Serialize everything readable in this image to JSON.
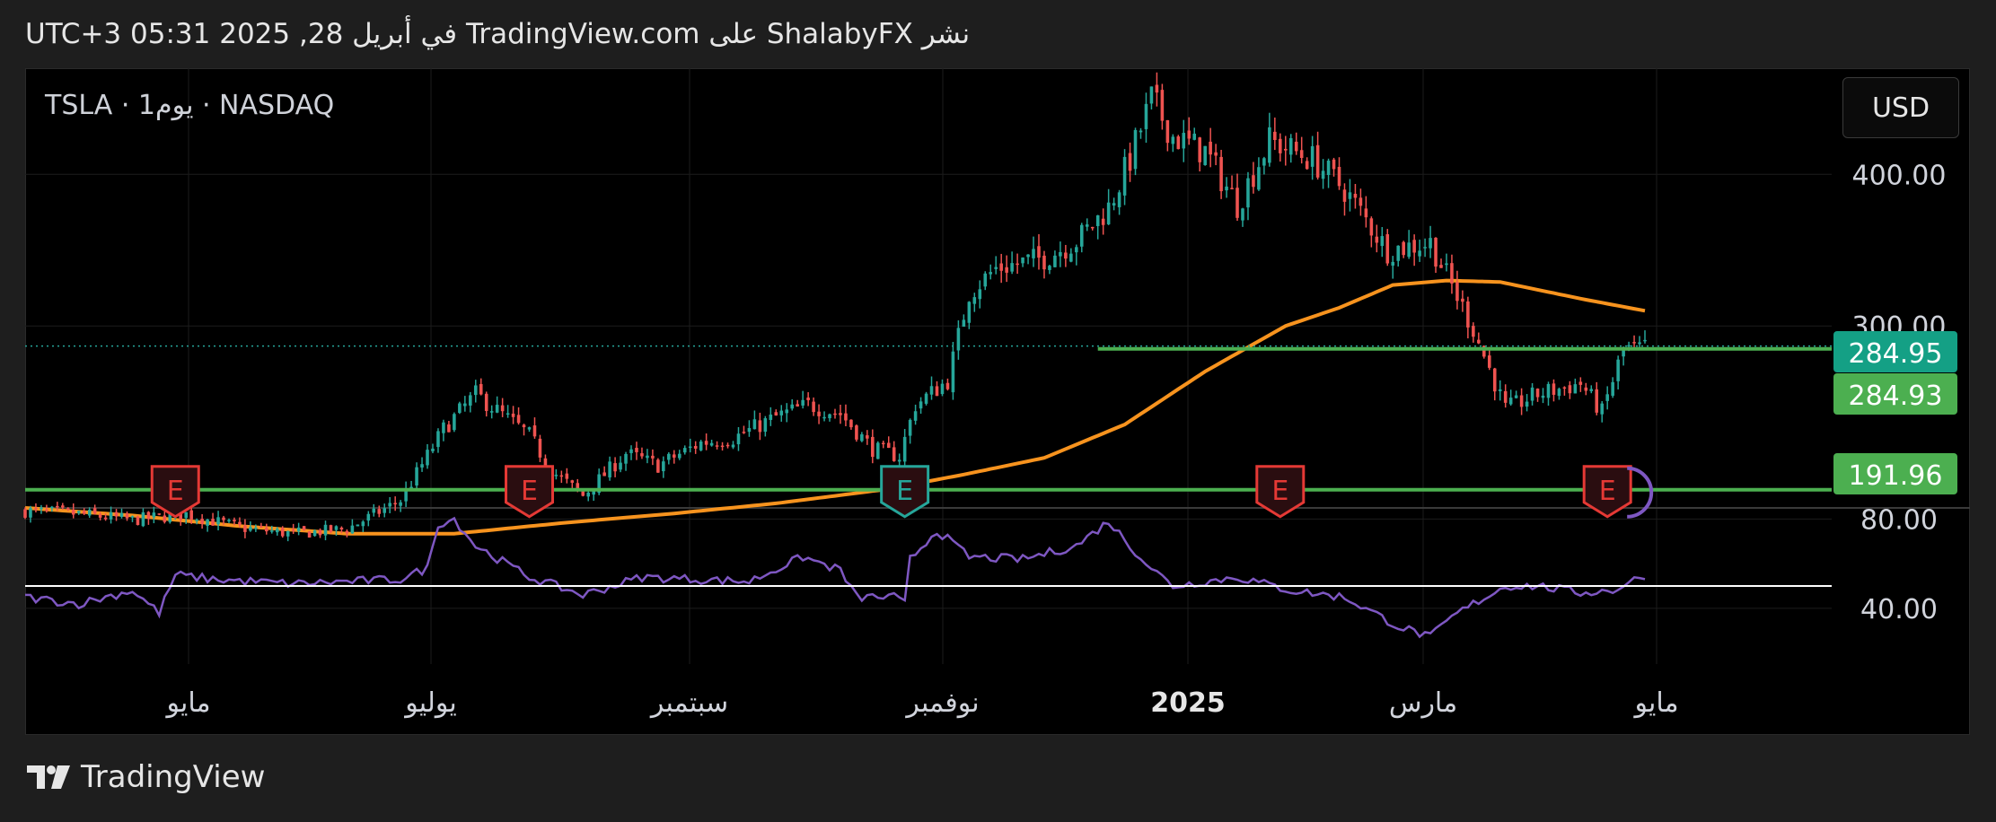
{
  "header": {
    "text": "نشر ShalabyFX على TradingView.com في أبريل 28, 2025 05:31 UTC+3"
  },
  "symbol_label": "TSLA · 1يوم · NASDAQ",
  "currency": "USD",
  "footer": {
    "brand": "TradingView"
  },
  "colors": {
    "up": "#26a69a",
    "down": "#ef5350",
    "ma": "#f7931e",
    "level": "#4caf50",
    "rsi": "#7e57c2",
    "rsi_mid": "#ffffff",
    "earnings_red": "#e53935",
    "earnings_teal": "#26a69a",
    "price_tag_teal": "#14a085",
    "price_tag_green": "#4caf50"
  },
  "chart_data": {
    "type": "candlestick",
    "price_axis": {
      "ticks": [
        "400.00",
        "300.00"
      ],
      "range": [
        180,
        470
      ]
    },
    "rsi_axis": {
      "ticks": [
        "80.00",
        "40.00"
      ],
      "range": [
        15,
        85
      ],
      "midline": 50
    },
    "x_axis": {
      "labels": [
        "مايو",
        "يوليو",
        "سبتمبر",
        "نوفمبر",
        "2025",
        "مارس",
        "مايو"
      ],
      "bold": [
        false,
        false,
        false,
        false,
        true,
        false,
        false
      ]
    },
    "last_price_tag": "284.95",
    "price_tags": [
      {
        "label": "284.93",
        "value": 284.93
      },
      {
        "label": "191.96",
        "value": 191.96
      }
    ],
    "levels": [
      {
        "value": 284.93,
        "from_index": 200
      },
      {
        "value": 191.96,
        "from_index": 0
      }
    ],
    "earnings": [
      {
        "index": 28,
        "kind": "red",
        "label": "E"
      },
      {
        "index": 94,
        "kind": "red",
        "label": "E"
      },
      {
        "index": 164,
        "kind": "teal",
        "label": "E"
      },
      {
        "index": 234,
        "kind": "red",
        "label": "E"
      },
      {
        "index": 295,
        "kind": "red",
        "label": "E"
      }
    ],
    "ma_anchors": [
      [
        0,
        180
      ],
      [
        20,
        175
      ],
      [
        40,
        168
      ],
      [
        60,
        163
      ],
      [
        80,
        163
      ],
      [
        100,
        170
      ],
      [
        120,
        176
      ],
      [
        140,
        183
      ],
      [
        160,
        192
      ],
      [
        175,
        202
      ],
      [
        190,
        213
      ],
      [
        205,
        235
      ],
      [
        220,
        270
      ],
      [
        235,
        300
      ],
      [
        245,
        312
      ],
      [
        255,
        327
      ],
      [
        265,
        330
      ],
      [
        275,
        329
      ],
      [
        290,
        318
      ],
      [
        302,
        310
      ]
    ],
    "close_anchors": [
      [
        0,
        178
      ],
      [
        10,
        176
      ],
      [
        20,
        172
      ],
      [
        30,
        176
      ],
      [
        40,
        167
      ],
      [
        50,
        163
      ],
      [
        60,
        166
      ],
      [
        70,
        185
      ],
      [
        78,
        232
      ],
      [
        84,
        255
      ],
      [
        94,
        228
      ],
      [
        98,
        205
      ],
      [
        104,
        188
      ],
      [
        112,
        216
      ],
      [
        118,
        208
      ],
      [
        126,
        223
      ],
      [
        132,
        226
      ],
      [
        140,
        240
      ],
      [
        146,
        248
      ],
      [
        152,
        242
      ],
      [
        158,
        219
      ],
      [
        163,
        214
      ],
      [
        166,
        248
      ],
      [
        172,
        264
      ],
      [
        176,
        322
      ],
      [
        181,
        338
      ],
      [
        190,
        345
      ],
      [
        196,
        356
      ],
      [
        202,
        378
      ],
      [
        206,
        410
      ],
      [
        210,
        450
      ],
      [
        214,
        425
      ],
      [
        220,
        415
      ],
      [
        226,
        380
      ],
      [
        232,
        422
      ],
      [
        240,
        410
      ],
      [
        246,
        390
      ],
      [
        254,
        350
      ],
      [
        262,
        355
      ],
      [
        270,
        298
      ],
      [
        276,
        245
      ],
      [
        282,
        255
      ],
      [
        290,
        262
      ],
      [
        294,
        243
      ],
      [
        298,
        285
      ],
      [
        302,
        285
      ]
    ],
    "rsi_anchors": [
      [
        0,
        45
      ],
      [
        10,
        42
      ],
      [
        20,
        48
      ],
      [
        25,
        38
      ],
      [
        28,
        55
      ],
      [
        35,
        53
      ],
      [
        50,
        51
      ],
      [
        70,
        53
      ],
      [
        75,
        58
      ],
      [
        77,
        78
      ],
      [
        80,
        80
      ],
      [
        84,
        68
      ],
      [
        94,
        54
      ],
      [
        104,
        46
      ],
      [
        115,
        54
      ],
      [
        135,
        52
      ],
      [
        145,
        63
      ],
      [
        152,
        57
      ],
      [
        155,
        45
      ],
      [
        162,
        45
      ],
      [
        164,
        42
      ],
      [
        165,
        62
      ],
      [
        170,
        75
      ],
      [
        176,
        63
      ],
      [
        186,
        62
      ],
      [
        196,
        68
      ],
      [
        202,
        79
      ],
      [
        206,
        68
      ],
      [
        210,
        58
      ],
      [
        214,
        50
      ],
      [
        226,
        54
      ],
      [
        236,
        48
      ],
      [
        246,
        45
      ],
      [
        256,
        32
      ],
      [
        262,
        27
      ],
      [
        266,
        36
      ],
      [
        270,
        42
      ],
      [
        276,
        50
      ],
      [
        282,
        50
      ],
      [
        290,
        47
      ],
      [
        296,
        48
      ],
      [
        302,
        55
      ]
    ]
  }
}
